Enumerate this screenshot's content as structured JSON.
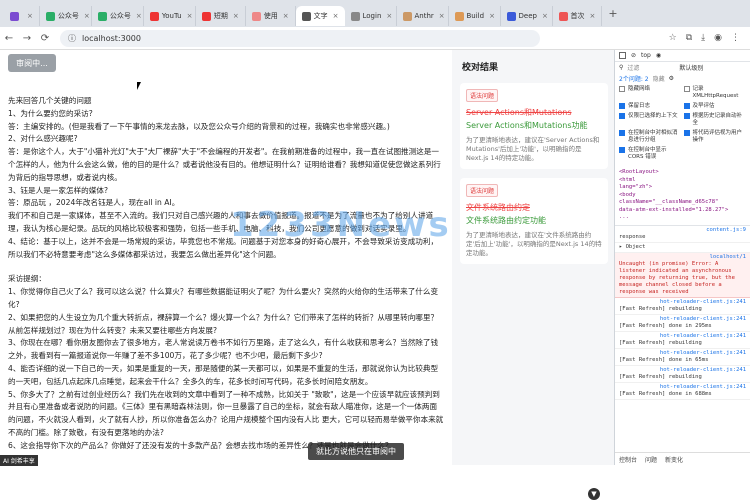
{
  "browser": {
    "tabs": [
      {
        "label": "",
        "color": "#7b4bd1"
      },
      {
        "label": "公众号",
        "color": "#2aae67"
      },
      {
        "label": "公众号",
        "color": "#2aae67"
      },
      {
        "label": "YouTu",
        "color": "#e33"
      },
      {
        "label": "短期",
        "color": "#e33"
      },
      {
        "label": "使用",
        "color": "#e88"
      },
      {
        "label": "文字",
        "color": "#555",
        "active": true
      },
      {
        "label": "Login",
        "color": "#888"
      },
      {
        "label": "Anthr",
        "color": "#c96"
      },
      {
        "label": "Build",
        "color": "#d95"
      },
      {
        "label": "Deep",
        "color": "#3b5ad9"
      },
      {
        "label": "首次",
        "color": "#e55"
      }
    ],
    "url": "localhost:3000"
  },
  "page": {
    "review_button": "审阅中...",
    "article": [
      "先来回答几个关键的问题",
      "1、为什么要约您的采访?",
      "答：主编安排的。(但是我看了一下午事情的来龙去脉，以及您公众号介绍的背景和的过程，我确实也非常感兴趣。)",
      "2、对什么感兴趣呢?",
      "答：是你这个人，大于\"小猫补光灯\"大于\"大厂裸辞\"大于\"不会编程的开发者\"。在我前期准备的过程中，我一直在试图推测这是一个怎样的人，他为什么会这么做，他的目的是什么？或者说他没有目的。他想证明什么？证明给谁看？我想知道促使您做这系列行为背后的指导思想，或者说内核。",
      "3、钰是人是一家怎样的媒体?",
      "答：原品玩      ，2024年改名钰是人，现在all in AI。",
      "我们不和自己是一家媒体，甚至不入流的。我们只对自己感兴趣的人和事去做价值报道。报道不是为了流量也不为了给别人讲道理，我认为核心是纪录。品玩的风格比较极客和强势，包括一些手机、电脑、科技，我们公司更愿意的做到对话实录里。",
      "4、结论：基于以上，这并不会是一场常规的采访，毕竟您也不常规。问题基于对您本身的好奇心展开，不会导致采访变成功利，所以我们不必特意要考虑\"这么多媒体都采访过，我要怎么做出差异化\"这个问题。",
      "",
      "采访提纲：",
      "1、你觉得你自己火了么？我可以这么说？什么算火？有哪些数据能证明火了呢？为什么要火？突然的火给你的生活带来了什么变化?",
      "2、如果把您的人生设立为几个重大转折点，裸辞算一个么？爆火算一个么？为什么？它们带来了怎样的转折？从哪里转向哪里？从前怎样规划过？现在为什么转变？未来又要往哪些方向发展?",
      "3、你现在在哪？看你朋友圈你去了很多地方，老人常说读万卷书不如行万里路，走了这么久，有什么收获和思考么？当然除了钱之外，我看到有一篇报道说你一年赚了差不多100万，花了多少呢？也不少吧，最后剩下多少?",
      "4、能否详细的说一下自己的一天，如果是重复的一天，那是随便的某一天都可以，如果是不重复的生活，那就说你认为比较典型的一天吧，包括几点起床几点睡觉，起来会干什么？全多久的车，花多长时间写代码，花多长时间陪女朋友。",
      "5、你多大了？之前有过创业经历么？我们先在收到的文章中看到了一种不成熟，比如关于      \"致歌\"，这是一个应该早就应该预判到并且有心里准备或者说防的问题。《三体》里有黑暗森林法则，你一旦暴露了自己的坐标，就会有敌人瞄准你，这是一个一体两面的问题，不火就没人看到，火了就有人抄，所以你准备怎么办？论用户规模整个国内没有人比      更大，它可以轻而易举做平你本来就不高的门槛。除了致敬，有没有更落地的办法?",
      "6、这会指导你下次的产品么？你做好了还没有发的十多款产品？会想去找市场的差异性么？还是也就是会做什么？"
    ]
  },
  "review": {
    "title": "校对结果",
    "cards": [
      {
        "badge": "语法问题",
        "deleted": "Server Actions和Mutations",
        "inserted": "Server Actions和Mutations功能",
        "note": "为了更清晰地表达，建议在'Server Actions和Mutations'后加上'功能'，以明确指的是Next.js 14的特定功能。"
      },
      {
        "badge": "语法问题",
        "deleted": "文件系统路由约定",
        "inserted": "文件系统路由约定功能",
        "note": "为了更清晰地表达，建议在'文件系统路由约定'后加上'功能'，以明确指的是Next.js 14的特定功能。"
      }
    ]
  },
  "devtools": {
    "filter_label": "过滤",
    "level": "默认级别",
    "issues": "2个问题: 2",
    "hidden": "隐藏",
    "options_left": [
      "隐藏网络",
      "保留日志",
      "仅限已选择的上下文",
      "在控制台中对相似消息进行分组",
      "在控制台中显示 CORS 错误"
    ],
    "options_right": [
      "记录 XMLHttpRequest",
      "及早评估",
      "根据历史记录自动补全",
      "将代码评估视为用户操作"
    ],
    "context": "top",
    "code_lines": [
      "<RootLayout>",
      "<html",
      "lang=\"zh\">",
      "<body",
      "className=\"__className_d65c78\"",
      "data-atm-ext-installed=\"1.28.27\">",
      "..."
    ],
    "console": [
      {
        "text": "response",
        "src": "content.js:9",
        "err": false
      },
      {
        "text": "▸ Object",
        "src": "",
        "err": false
      },
      {
        "text": "Uncaught (in promise) Error: A listener indicated an asynchronous response by returning true, but the message channel closed before a response was received",
        "src": "localhost/1",
        "err": true
      },
      {
        "text": "[Fast Refresh] rebuilding",
        "src": "hot-reloader-client.js:241",
        "err": false
      },
      {
        "text": "[Fast Refresh] done in 295ms",
        "src": "hot-reloader-client.js:241",
        "err": false
      },
      {
        "text": "[Fast Refresh] rebuilding",
        "src": "hot-reloader-client.js:241",
        "err": false
      },
      {
        "text": "[Fast Refresh] done in 65ms",
        "src": "hot-reloader-client.js:241",
        "err": false
      },
      {
        "text": "[Fast Refresh] rebuilding",
        "src": "hot-reloader-client.js:241",
        "err": false
      },
      {
        "text": "[Fast Refresh] done in 688ms",
        "src": "hot-reloader-client.js:241",
        "err": false
      }
    ],
    "bottom_tabs": [
      "控制台",
      "问题",
      "新变化"
    ]
  },
  "overlay": {
    "watermark": "1233News",
    "subtitle": "就比方说他只在审阅中",
    "corner_label": "AI 剑希丰享"
  }
}
